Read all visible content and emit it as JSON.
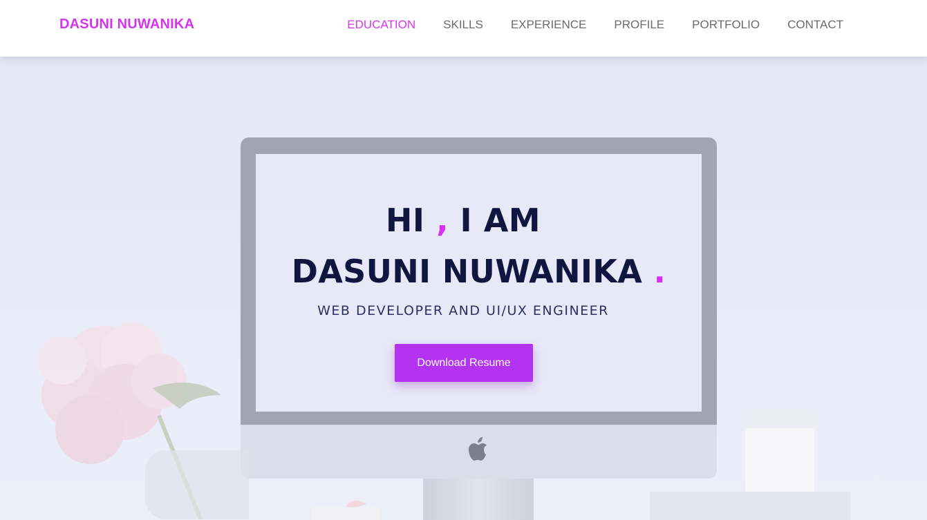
{
  "header": {
    "brand": "DASUNI NUWANIKA",
    "nav": [
      {
        "label": "EDUCATION",
        "active": true
      },
      {
        "label": "SKILLS",
        "active": false
      },
      {
        "label": "EXPERIENCE",
        "active": false
      },
      {
        "label": "PROFILE",
        "active": false
      },
      {
        "label": "PORTFOLIO",
        "active": false
      },
      {
        "label": "CONTACT",
        "active": false
      }
    ]
  },
  "hero": {
    "greeting_start": "HI ",
    "greeting_comma": ",",
    "greeting_end": " I AM",
    "name": "DASUNI NUWANIKA",
    "name_dot": " .",
    "role": "WEB DEVELOPER AND UI/UX ENGINEER",
    "button_label": "Download Resume"
  },
  "colors": {
    "accent": "#d633f0",
    "button": "#b433f0",
    "heading": "#101640"
  }
}
